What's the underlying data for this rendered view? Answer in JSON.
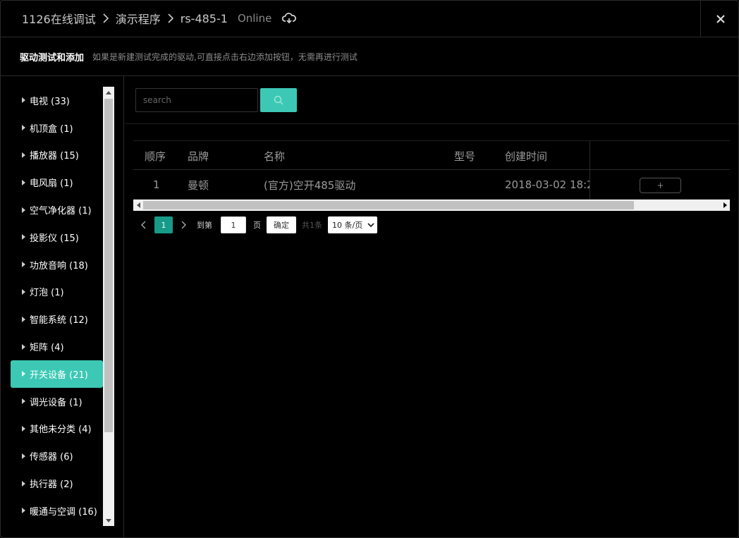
{
  "breadcrumb": [
    "1126在线调试",
    "演示程序",
    "rs-485-1"
  ],
  "status": "Online",
  "subheader": {
    "title": "驱动测试和添加",
    "hint": "如果是新建测试完成的驱动,可直接点击右边添加按钮，无需再进行测试"
  },
  "sidebar": {
    "items": [
      {
        "label": "电视 (33)"
      },
      {
        "label": "机顶盒 (1)"
      },
      {
        "label": "播放器 (15)"
      },
      {
        "label": "电风扇 (1)"
      },
      {
        "label": "空气净化器 (1)"
      },
      {
        "label": "投影仪 (15)"
      },
      {
        "label": "功放音响 (18)"
      },
      {
        "label": "灯泡 (1)"
      },
      {
        "label": "智能系统 (12)"
      },
      {
        "label": "矩阵 (4)"
      },
      {
        "label": "开关设备 (21)",
        "active": true
      },
      {
        "label": "调光设备 (1)"
      },
      {
        "label": "其他未分类 (4)"
      },
      {
        "label": "传感器 (6)"
      },
      {
        "label": "执行器 (2)"
      },
      {
        "label": "暖通与空调 (16)"
      }
    ]
  },
  "search": {
    "placeholder": "search",
    "value": ""
  },
  "table": {
    "headers": {
      "order": "顺序",
      "brand": "品牌",
      "name": "名称",
      "model": "型号",
      "created": "创建时间"
    },
    "rows": [
      {
        "order": "1",
        "brand": "曼顿",
        "name": "(官方)空开485驱动",
        "model": "",
        "created": "2018-03-02 18:2",
        "action": "+"
      }
    ]
  },
  "pagination": {
    "current_page": "1",
    "goto_label": "到第",
    "goto_value": "1",
    "page_label": "页",
    "confirm_label": "确定",
    "total_label": "共1条",
    "page_size": "10 条/页"
  },
  "colors": {
    "accent": "#3cc8b4",
    "background": "#000000"
  }
}
